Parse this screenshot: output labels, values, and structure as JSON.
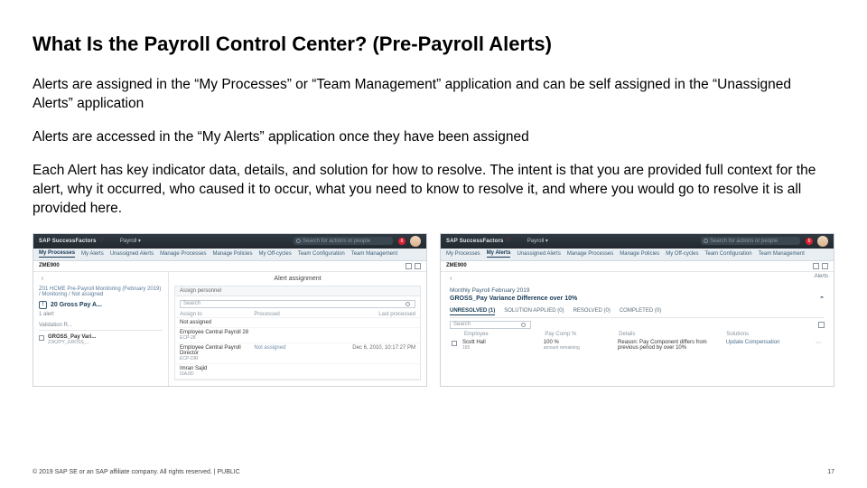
{
  "slide": {
    "title": "What Is the Payroll Control Center? (Pre-Payroll Alerts)",
    "p1": "Alerts are assigned in the “My Processes” or “Team Management” application and can be self assigned in the “Unassigned Alerts” application",
    "p2": "Alerts are accessed in the “My Alerts” application once they have been assigned",
    "p3": "Each Alert has key indicator data, details, and solution for how to resolve. The intent is that you are provided full context for the alert, why it occurred, who caused it to occur, what you need to know to resolve it, and where you would go to resolve it is all provided here."
  },
  "brand": "SAP SuccessFactors",
  "module": "Payroll",
  "search_placeholder": "Search for actions or people",
  "notif_count": "6",
  "nav_items": [
    "My Processes",
    "My Alerts",
    "Unassigned Alerts",
    "Manage Processes",
    "Manage Policies",
    "My Off-cycles",
    "Team Configuration",
    "Team Management"
  ],
  "page_code": "ZME900",
  "left": {
    "chev": "‹",
    "breadcrumb": "Z01 HCME Pre-Payroll Monitoring (February 2019)  /  Monitoring  /  Not assigned",
    "alert_title": "20 Gross Pay A...",
    "count_label": "1 alert",
    "col_validation": "Validation R...",
    "assign_caption": "Alert assignment",
    "panel_label": "Assign personnel",
    "srch": "Search",
    "cols": [
      "Assign to",
      "Processed",
      "Last processed"
    ],
    "rows": [
      {
        "name": "Not assigned",
        "sub": "",
        "proc": "",
        "last": ""
      },
      {
        "name": "Employee Central Payroll 28",
        "sub": "ECP-28",
        "proc": "",
        "last": ""
      },
      {
        "name": "Employee Central Payroll Director",
        "sub": "ECP-DIR",
        "proc": "Not assigned",
        "last": "Dec 6, 2010, 10:17:27 PM"
      },
      {
        "name": "Imran Sajid",
        "sub": "ISAJID",
        "proc": "",
        "last": ""
      }
    ],
    "bottom_row": {
      "name": "GROSS_Pay Vari...",
      "code": "Z3KZPY_GROSS_..."
    }
  },
  "right": {
    "chev": "‹",
    "side_label": "Alerts",
    "context": "Monthly Payroll February 2019",
    "atitle": "GROSS_Pay Variance Difference over 10%",
    "atitle_caret": "⌃",
    "tabs": [
      {
        "label": "UNRESOLVED (1)",
        "active": true
      },
      {
        "label": "SOLUTION APPLIED (0)",
        "active": false
      },
      {
        "label": "RESOLVED (0)",
        "active": false
      },
      {
        "label": "COMPLETED (0)",
        "active": false
      }
    ],
    "srch": "Search",
    "grid_headers": [
      "",
      "Employee",
      "Pay Comp %",
      "Details",
      "Solutions",
      ""
    ],
    "row": {
      "emp": "Scott Hall",
      "emp_sub": "165",
      "pct": "100 %",
      "pct_sub": "amount remaining",
      "details": "Reason: Pay Component differs from previous period by over 10%",
      "solution": "Update Compensation",
      "dots": "⋯"
    }
  },
  "footer": {
    "left": "© 2019 SAP SE or an SAP affiliate company. All rights reserved.  |  PUBLIC",
    "page": "17"
  }
}
